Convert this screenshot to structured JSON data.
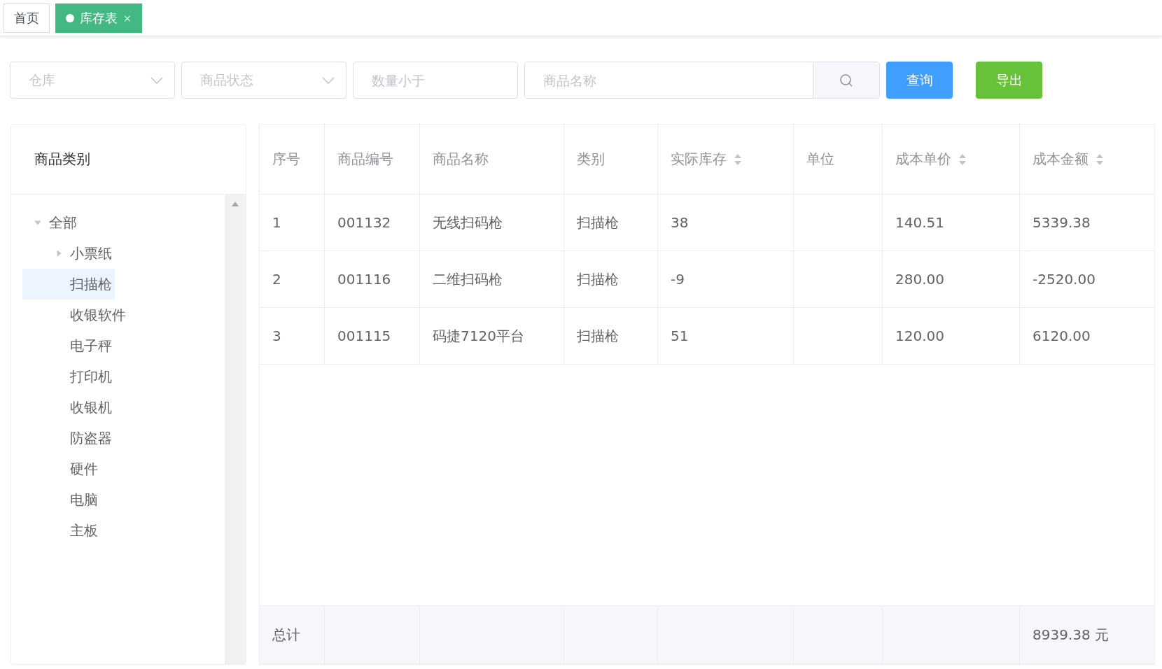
{
  "tabs": [
    {
      "label": "首页",
      "selected": false
    },
    {
      "label": "库存表",
      "selected": true,
      "close": "×"
    }
  ],
  "filters": {
    "warehouse": {
      "placeholder": "仓库"
    },
    "status": {
      "placeholder": "商品状态"
    },
    "quantity": {
      "placeholder": "数量小于"
    },
    "name": {
      "placeholder": "商品名称"
    },
    "query_button": "查询",
    "export_button": "导出"
  },
  "sidebar": {
    "title": "商品类别",
    "tree": [
      {
        "label": "全部",
        "selected": false,
        "expanded": true,
        "children": [
          {
            "label": "小票纸",
            "selected": false,
            "expanded": false
          },
          {
            "label": "扫描枪",
            "selected": true
          },
          {
            "label": "收银软件",
            "selected": false
          },
          {
            "label": "电子秤",
            "selected": false
          },
          {
            "label": "打印机",
            "selected": false
          },
          {
            "label": "收银机",
            "selected": false
          },
          {
            "label": "防盗器",
            "selected": false
          },
          {
            "label": "硬件",
            "selected": false
          },
          {
            "label": "电脑",
            "selected": false
          },
          {
            "label": "主板",
            "selected": false
          }
        ]
      }
    ]
  },
  "table": {
    "columns": [
      {
        "label": "序号",
        "sortable": false
      },
      {
        "label": "商品编号",
        "sortable": false
      },
      {
        "label": "商品名称",
        "sortable": false
      },
      {
        "label": "类别",
        "sortable": false
      },
      {
        "label": "实际库存",
        "sortable": true
      },
      {
        "label": "单位",
        "sortable": false
      },
      {
        "label": "成本单价",
        "sortable": true
      },
      {
        "label": "成本金额",
        "sortable": true
      }
    ],
    "rows": [
      [
        "1",
        "001132",
        "无线扫码枪",
        "扫描枪",
        "38",
        "",
        "140.51",
        "5339.38"
      ],
      [
        "2",
        "001116",
        "二维扫码枪",
        "扫描枪",
        "-9",
        "",
        "280.00",
        "-2520.00"
      ],
      [
        "3",
        "001115",
        "码捷7120平台",
        "扫描枪",
        "51",
        "",
        "120.00",
        "6120.00"
      ]
    ],
    "footer": {
      "label": "总计",
      "total": "8939.38 元"
    }
  }
}
